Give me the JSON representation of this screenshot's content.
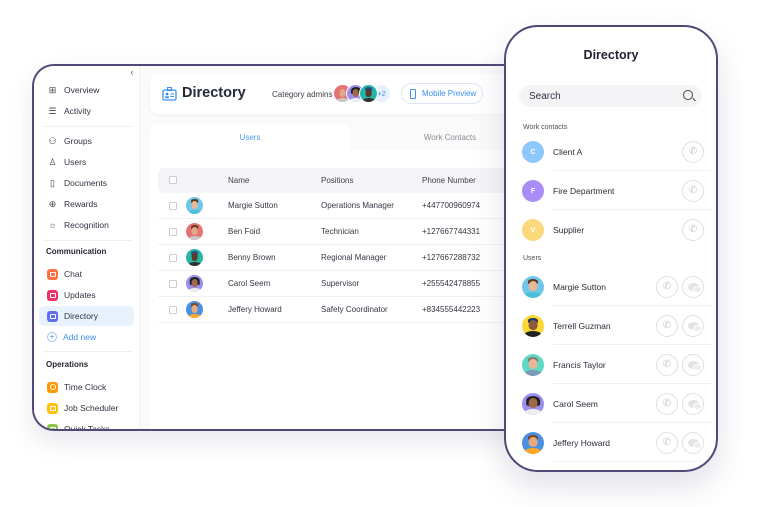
{
  "window": {
    "sidebar": {
      "collapse_icon": "chevron-left-icon",
      "items_top": [
        {
          "label": "Overview",
          "icon": "grid-icon",
          "glyph": "⊞"
        },
        {
          "label": "Activity",
          "icon": "list-icon",
          "glyph": "☰"
        }
      ],
      "items_people": [
        {
          "label": "Groups",
          "icon": "groups-icon",
          "glyph": "⚇"
        },
        {
          "label": "Users",
          "icon": "user-icon",
          "glyph": "♙"
        },
        {
          "label": "Documents",
          "icon": "document-icon",
          "glyph": "▯"
        },
        {
          "label": "Rewards",
          "icon": "gift-icon",
          "glyph": "⊕"
        },
        {
          "label": "Recognition",
          "icon": "sun-icon",
          "glyph": "☼"
        }
      ],
      "section_communication": "Communication",
      "communication": [
        {
          "label": "Chat",
          "icon": "chat-icon",
          "color": "#ff7043"
        },
        {
          "label": "Updates",
          "icon": "updates-icon",
          "color": "#f0306a"
        },
        {
          "label": "Directory",
          "icon": "directory-icon",
          "color": "#5c6ff2",
          "active": true
        }
      ],
      "add_new": "Add new",
      "section_operations": "Operations",
      "operations": [
        {
          "label": "Time Clock",
          "icon": "clock-icon",
          "color": "#ff9800"
        },
        {
          "label": "Job Scheduler",
          "icon": "briefcase-icon",
          "color": "#ffc107"
        },
        {
          "label": "Quick Tasks",
          "icon": "tasks-icon",
          "color": "#8bc34a"
        }
      ]
    },
    "header": {
      "title": "Directory",
      "category_admins_label": "Category admins",
      "admins_more": "+2",
      "mobile_preview": "Mobile Preview"
    },
    "tabs": [
      {
        "label": "Users",
        "active": true
      },
      {
        "label": "Work Contacts",
        "active": false
      }
    ],
    "table": {
      "columns": [
        "Name",
        "Positions",
        "Phone Number"
      ],
      "rows": [
        {
          "name": "Margie Sutton",
          "position": "Operations Manager",
          "phone": "+447700960974"
        },
        {
          "name": "Ben Foid",
          "position": "Technician",
          "phone": "+127667744331"
        },
        {
          "name": "Benny Brown",
          "position": "Regional Manager",
          "phone": "+127667288732"
        },
        {
          "name": "Carol Seem",
          "position": "Supervisor",
          "phone": "+255542478855"
        },
        {
          "name": "Jeffery Howard",
          "position": "Safety Coordinator",
          "phone": "+834555442223"
        }
      ]
    }
  },
  "phone": {
    "title": "Directory",
    "search_placeholder": "Search",
    "section_work": "Work contacts",
    "work_contacts": [
      {
        "initial": "C",
        "name": "Client A",
        "color": "#8ec7fb"
      },
      {
        "initial": "F",
        "name": "Fire Department",
        "color": "#a98cf5"
      },
      {
        "initial": "V",
        "name": "Supplier",
        "color": "#fbd97a"
      }
    ],
    "section_users": "Users",
    "users": [
      {
        "name": "Margie Sutton"
      },
      {
        "name": "Terrell Guzman"
      },
      {
        "name": "Francis Taylor"
      },
      {
        "name": "Carol Seem"
      },
      {
        "name": "Jeffery Howard"
      }
    ]
  }
}
